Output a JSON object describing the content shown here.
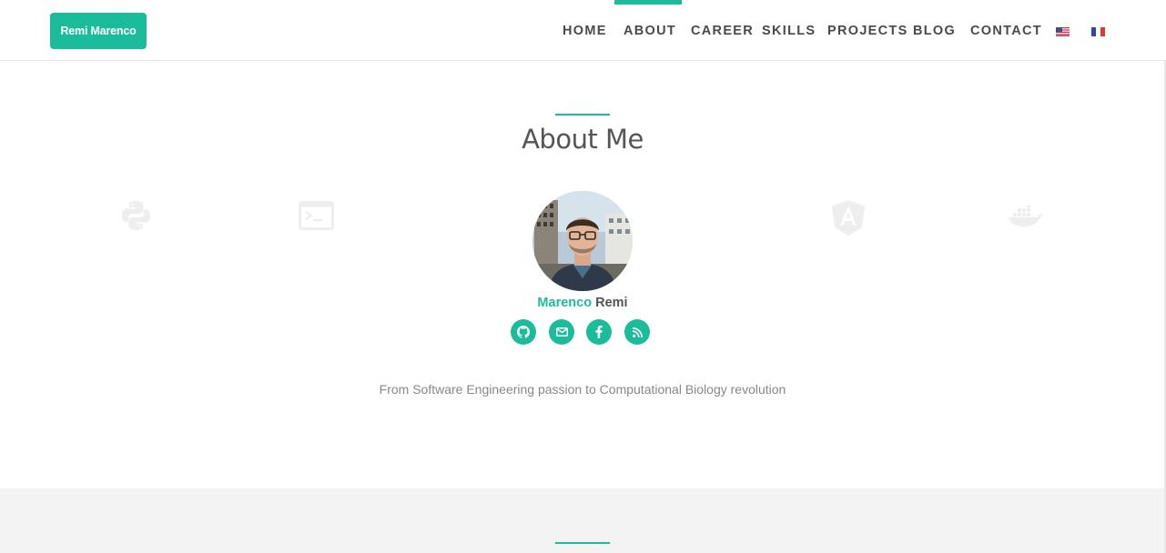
{
  "header": {
    "brand": "Remi Marenco",
    "nav": [
      {
        "label": "HOME",
        "active": false
      },
      {
        "label": "ABOUT",
        "active": true
      },
      {
        "label": "CAREER",
        "active": false
      },
      {
        "label": "SKILLS",
        "active": false
      },
      {
        "label": "PROJECTS",
        "active": false
      },
      {
        "label": "BLOG",
        "active": false
      },
      {
        "label": "CONTACT",
        "active": false
      }
    ],
    "languages": [
      "us-flag-icon",
      "fr-flag-icon"
    ]
  },
  "about": {
    "title": "About Me",
    "first_name": "Marenco",
    "last_name": "Remi",
    "tagline": "From Software Engineering passion to Computational Biology revolution",
    "tech_icons": [
      "python-icon",
      "terminal-icon",
      "angular-icon",
      "docker-icon"
    ],
    "social": [
      "github-icon",
      "envelope-icon",
      "facebook-icon",
      "rss-icon"
    ]
  },
  "colors": {
    "accent": "#1abc9c",
    "text": "#555555",
    "muted": "#888888",
    "section_grey": "#f3f3f3"
  }
}
